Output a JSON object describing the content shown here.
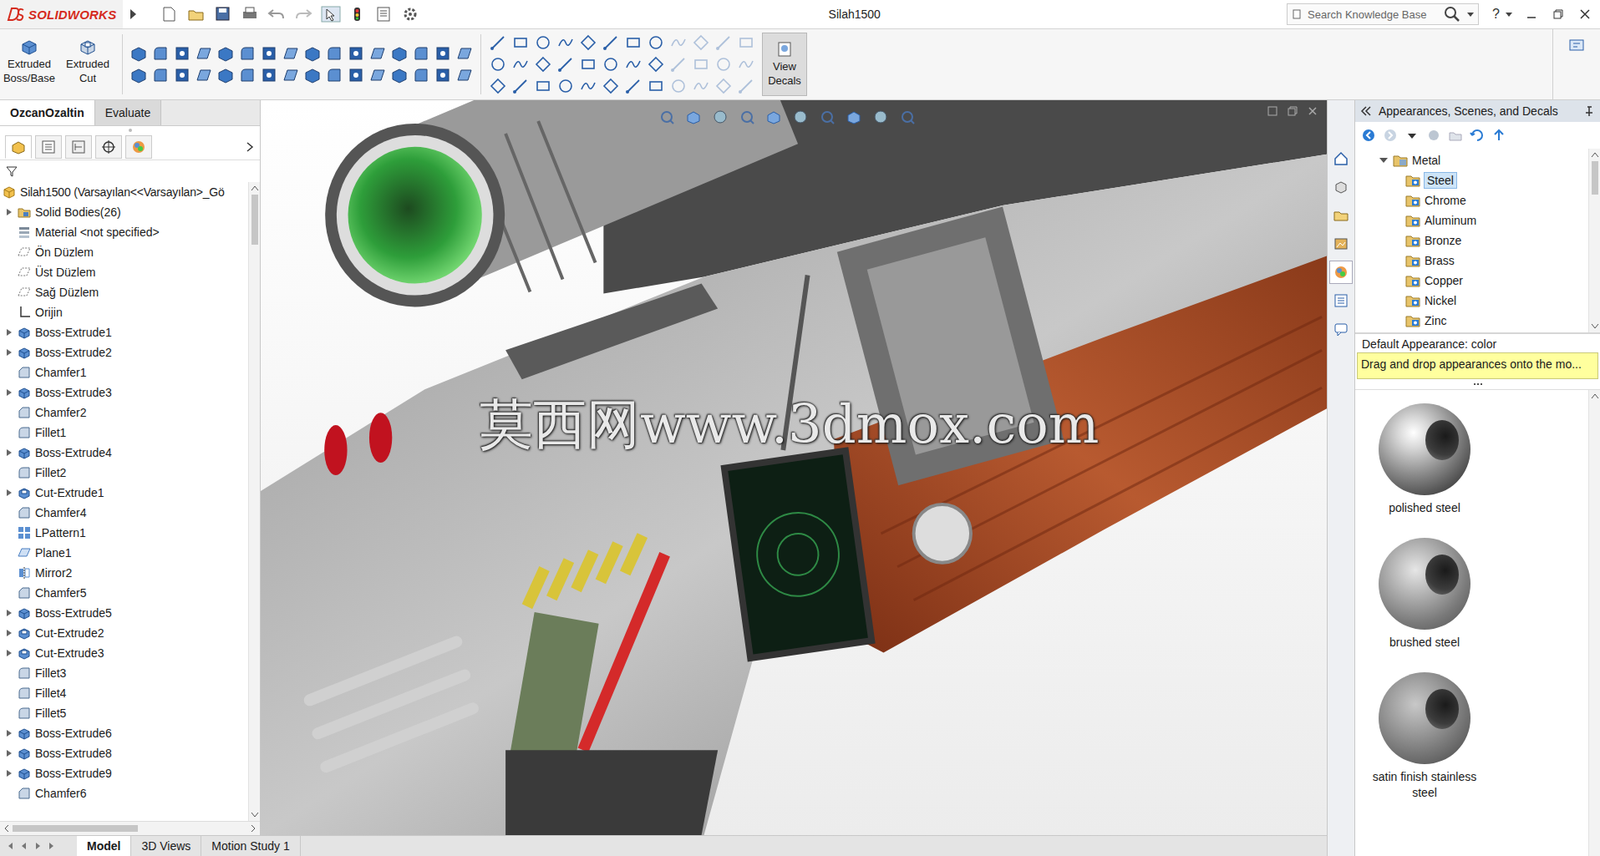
{
  "window": {
    "title": "Silah1500",
    "logo": "SOLIDWORKS",
    "help": "?"
  },
  "search": {
    "placeholder": "Search Knowledge Base"
  },
  "ribbon": {
    "buttons": [
      {
        "label": "Extruded Boss/Base"
      },
      {
        "label": "Extruded Cut"
      }
    ],
    "view_decals": {
      "label": "View Decals",
      "selected": true
    }
  },
  "command_tabs": [
    {
      "label": "OzcanOzaltin",
      "selected": true
    },
    {
      "label": "Evaluate",
      "selected": false
    }
  ],
  "feature_tree": {
    "items": [
      {
        "label": "Silah1500 (Varsayılan<<Varsayılan>_Gö",
        "kind": "root",
        "expandable": false
      },
      {
        "label": "Solid Bodies(26)",
        "kind": "folder",
        "expandable": true
      },
      {
        "label": "Material <not specified>",
        "kind": "material",
        "expandable": false
      },
      {
        "label": "Ön Düzlem",
        "kind": "plane",
        "expandable": false
      },
      {
        "label": "Üst Düzlem",
        "kind": "plane",
        "expandable": false
      },
      {
        "label": "Sağ Düzlem",
        "kind": "plane",
        "expandable": false
      },
      {
        "label": "Orijin",
        "kind": "origin",
        "expandable": false
      },
      {
        "label": "Boss-Extrude1",
        "kind": "boss",
        "expandable": true
      },
      {
        "label": "Boss-Extrude2",
        "kind": "boss",
        "expandable": true
      },
      {
        "label": "Chamfer1",
        "kind": "chamfer",
        "expandable": false
      },
      {
        "label": "Boss-Extrude3",
        "kind": "boss",
        "expandable": true
      },
      {
        "label": "Chamfer2",
        "kind": "chamfer",
        "expandable": false
      },
      {
        "label": "Fillet1",
        "kind": "fillet",
        "expandable": false
      },
      {
        "label": "Boss-Extrude4",
        "kind": "boss",
        "expandable": true
      },
      {
        "label": "Fillet2",
        "kind": "fillet",
        "expandable": false
      },
      {
        "label": "Cut-Extrude1",
        "kind": "cut",
        "expandable": true
      },
      {
        "label": "Chamfer4",
        "kind": "chamfer",
        "expandable": false
      },
      {
        "label": "LPattern1",
        "kind": "pattern",
        "expandable": false
      },
      {
        "label": "Plane1",
        "kind": "refplane",
        "expandable": false
      },
      {
        "label": "Mirror2",
        "kind": "mirror",
        "expandable": false
      },
      {
        "label": "Chamfer5",
        "kind": "chamfer",
        "expandable": false
      },
      {
        "label": "Boss-Extrude5",
        "kind": "boss",
        "expandable": true
      },
      {
        "label": "Cut-Extrude2",
        "kind": "cut",
        "expandable": true
      },
      {
        "label": "Cut-Extrude3",
        "kind": "cut",
        "expandable": true
      },
      {
        "label": "Fillet3",
        "kind": "fillet",
        "expandable": false
      },
      {
        "label": "Fillet4",
        "kind": "fillet",
        "expandable": false
      },
      {
        "label": "Fillet5",
        "kind": "fillet",
        "expandable": false
      },
      {
        "label": "Boss-Extrude6",
        "kind": "boss",
        "expandable": true
      },
      {
        "label": "Boss-Extrude8",
        "kind": "boss",
        "expandable": true
      },
      {
        "label": "Boss-Extrude9",
        "kind": "boss",
        "expandable": true
      },
      {
        "label": "Chamfer6",
        "kind": "chamfer",
        "expandable": false
      }
    ]
  },
  "viewport": {
    "watermark": "莫西网www.3dmox.com"
  },
  "task_pane": {
    "title": "Appearances, Scenes, and Decals",
    "tree": [
      {
        "label": "Metal",
        "expanded": true,
        "children": [
          {
            "label": "Steel",
            "selected": true
          },
          {
            "label": "Chrome",
            "selected": false
          },
          {
            "label": "Aluminum",
            "selected": false
          },
          {
            "label": "Bronze",
            "selected": false
          },
          {
            "label": "Brass",
            "selected": false
          },
          {
            "label": "Copper",
            "selected": false
          },
          {
            "label": "Nickel",
            "selected": false
          },
          {
            "label": "Zinc",
            "selected": false
          }
        ]
      }
    ],
    "default_appearance": "Default Appearance: color",
    "tip": "Drag and drop appearances onto the mo...",
    "swatches": [
      {
        "label": "polished steel",
        "kind": "polished"
      },
      {
        "label": "brushed steel",
        "kind": "brushed"
      },
      {
        "label": "satin finish stainless steel",
        "kind": "satin"
      }
    ]
  },
  "bottom_tabs": [
    {
      "label": "Model",
      "selected": true
    },
    {
      "label": "3D Views",
      "selected": false
    },
    {
      "label": "Motion Study 1",
      "selected": false
    }
  ]
}
